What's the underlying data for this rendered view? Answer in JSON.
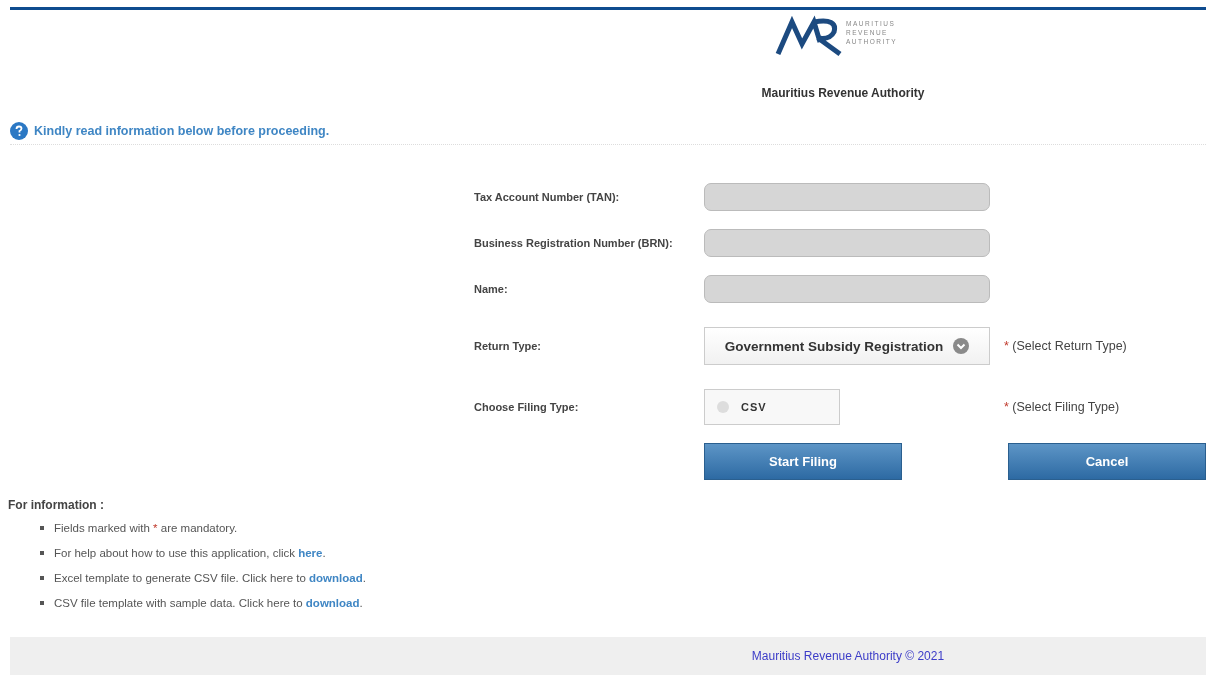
{
  "header": {
    "logo_text": [
      "MAURITIUS",
      "REVENUE",
      "AUTHORITY"
    ],
    "title": "Mauritius Revenue Authority"
  },
  "notice": "Kindly read information below before proceeding.",
  "form": {
    "rows": [
      {
        "kind": "text",
        "label": "Tax Account Number (TAN):",
        "disabled": true
      },
      {
        "kind": "text",
        "label": "Business Registration Number (BRN):",
        "disabled": true
      },
      {
        "kind": "text",
        "label": "Name:",
        "disabled": true
      },
      {
        "kind": "select",
        "label": "Return Type:",
        "value": "Government Subsidy Registration",
        "required_mark": "*",
        "hint": "(Select Return Type)"
      },
      {
        "kind": "radio",
        "label": "Choose Filing Type:",
        "options": [
          {
            "label": "CSV",
            "selected": false
          }
        ],
        "required_mark": "*",
        "hint": "(Select Filing Type)"
      }
    ],
    "buttons": [
      "Start Filing",
      "Cancel"
    ]
  },
  "info": {
    "title": "For information :",
    "items": [
      [
        {
          "kind": "text",
          "text": "Fields marked with "
        },
        {
          "kind": "required",
          "text": "*"
        },
        {
          "kind": "text",
          "text": " are mandatory."
        }
      ],
      [
        {
          "kind": "text",
          "text": "For help about how to use this application, click "
        },
        {
          "kind": "link",
          "text": "here"
        },
        {
          "kind": "text",
          "text": "."
        }
      ],
      [
        {
          "kind": "text",
          "text": "Excel template to generate CSV file. Click here to "
        },
        {
          "kind": "link",
          "text": "download"
        },
        {
          "kind": "text",
          "text": "."
        }
      ],
      [
        {
          "kind": "text",
          "text": "CSV file template with sample data. Click here to "
        },
        {
          "kind": "link",
          "text": "download"
        },
        {
          "kind": "text",
          "text": "."
        }
      ]
    ]
  },
  "footer": "Mauritius Revenue Authority © 2021"
}
